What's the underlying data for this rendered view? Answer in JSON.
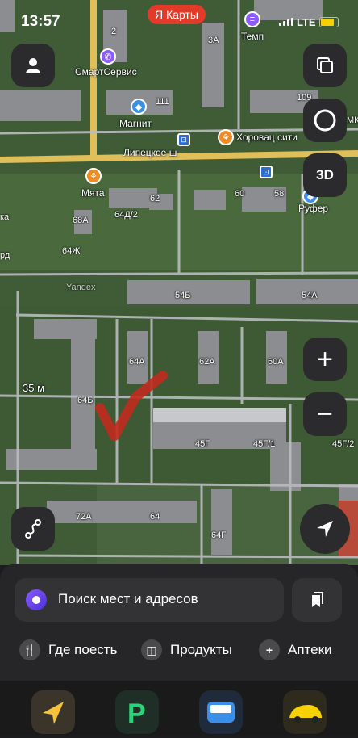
{
  "status_bar": {
    "time": "13:57",
    "network": "LTE",
    "battery_level": 0.85
  },
  "app": {
    "brand": "Я Карты"
  },
  "map_labels": {
    "pois": [
      "СмартСервис",
      "Магнит",
      "Хоровац сити",
      "Темп",
      "Мята",
      "Руфер",
      "Yandex"
    ],
    "street": "Липецкое ш",
    "house_numbers": [
      "2",
      "3А",
      "111",
      "109",
      "62",
      "60",
      "58",
      "68А",
      "64Д/2",
      "64Ж",
      "54Б",
      "54А",
      "64А",
      "62А",
      "60А",
      "64Б",
      "45Г",
      "45Г/1",
      "45Г/2",
      "72А",
      "64",
      "64Г",
      "МК",
      "ка",
      "рд"
    ],
    "distance": "35 м"
  },
  "map_controls": {
    "profile": "profile-icon",
    "layers": "layers-icon",
    "compass": "compass-icon",
    "three_d": "3D",
    "zoom_in": "+",
    "zoom_out": "−",
    "route": "route-icon",
    "locate": "location-arrow-icon"
  },
  "bottom_panel": {
    "search_placeholder": "Поиск мест и адресов",
    "categories": [
      {
        "label": "Где поесть",
        "icon": "fork-knife-icon"
      },
      {
        "label": "Продукты",
        "icon": "basket-icon"
      },
      {
        "label": "Аптеки",
        "icon": "plus-icon"
      }
    ]
  },
  "colors": {
    "accent_red": "#e33a2a",
    "panel": "#262628",
    "alice": "#6a3fff"
  }
}
